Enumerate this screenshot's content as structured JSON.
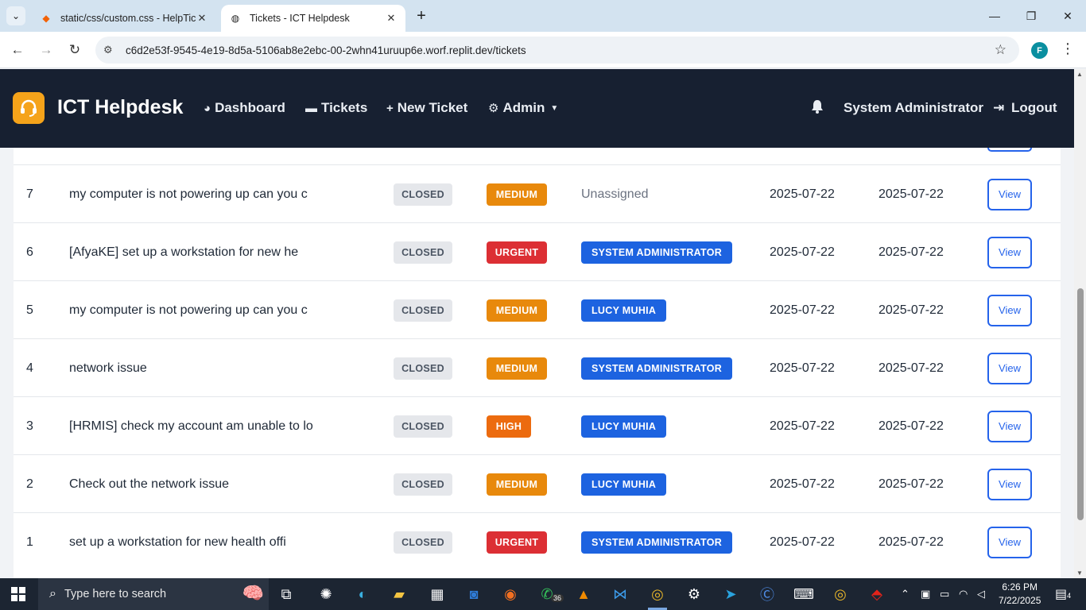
{
  "browser": {
    "tabs": [
      {
        "title": "static/css/custom.css - HelpTick",
        "active": false
      },
      {
        "title": "Tickets - ICT Helpdesk",
        "active": true
      }
    ],
    "url": "c6d2e53f-9545-4e19-8d5a-5106ab8e2ebc-00-2whn41uruup6e.worf.replit.dev/tickets",
    "profile_initial": "F"
  },
  "app": {
    "brand": "ICT Helpdesk",
    "nav": {
      "dashboard": "Dashboard",
      "tickets": "Tickets",
      "new_ticket": "New Ticket",
      "admin": "Admin"
    },
    "user": "System Administrator",
    "logout": "Logout"
  },
  "tickets": [
    {
      "id": "7",
      "title": "my computer is not powering up can you c",
      "status": "CLOSED",
      "priority": "MEDIUM",
      "priority_level": "medium",
      "assignee": "Unassigned",
      "assigned": false,
      "created": "2025-07-22",
      "updated": "2025-07-22",
      "action": "View"
    },
    {
      "id": "6",
      "title": "[AfyaKE] set up a workstation for new he",
      "status": "CLOSED",
      "priority": "URGENT",
      "priority_level": "urgent",
      "assignee": "SYSTEM ADMINISTRATOR",
      "assigned": true,
      "created": "2025-07-22",
      "updated": "2025-07-22",
      "action": "View"
    },
    {
      "id": "5",
      "title": "my computer is not powering up can you c",
      "status": "CLOSED",
      "priority": "MEDIUM",
      "priority_level": "medium",
      "assignee": "LUCY MUHIA",
      "assigned": true,
      "created": "2025-07-22",
      "updated": "2025-07-22",
      "action": "View"
    },
    {
      "id": "4",
      "title": "network issue",
      "status": "CLOSED",
      "priority": "MEDIUM",
      "priority_level": "medium",
      "assignee": "SYSTEM ADMINISTRATOR",
      "assigned": true,
      "created": "2025-07-22",
      "updated": "2025-07-22",
      "action": "View"
    },
    {
      "id": "3",
      "title": "[HRMIS] check my account am unable to lo",
      "status": "CLOSED",
      "priority": "HIGH",
      "priority_level": "high",
      "assignee": "LUCY MUHIA",
      "assigned": true,
      "created": "2025-07-22",
      "updated": "2025-07-22",
      "action": "View"
    },
    {
      "id": "2",
      "title": "Check out the network issue",
      "status": "CLOSED",
      "priority": "MEDIUM",
      "priority_level": "medium",
      "assignee": "LUCY MUHIA",
      "assigned": true,
      "created": "2025-07-22",
      "updated": "2025-07-22",
      "action": "View"
    },
    {
      "id": "1",
      "title": "set up a workstation for new health offi",
      "status": "CLOSED",
      "priority": "URGENT",
      "priority_level": "urgent",
      "assignee": "SYSTEM ADMINISTRATOR",
      "assigned": true,
      "created": "2025-07-22",
      "updated": "2025-07-22",
      "action": "View"
    }
  ],
  "colors": {
    "navbar": "#172031",
    "brand_logo": "#f5a31a",
    "primary": "#2563eb",
    "medium": "#e8890c",
    "urgent": "#dc2f34",
    "high": "#ec6b0f"
  },
  "taskbar": {
    "search_placeholder": "Type here to search",
    "whatsapp_count": "36",
    "time": "6:26 PM",
    "date": "7/22/2025",
    "notifications": "4"
  }
}
